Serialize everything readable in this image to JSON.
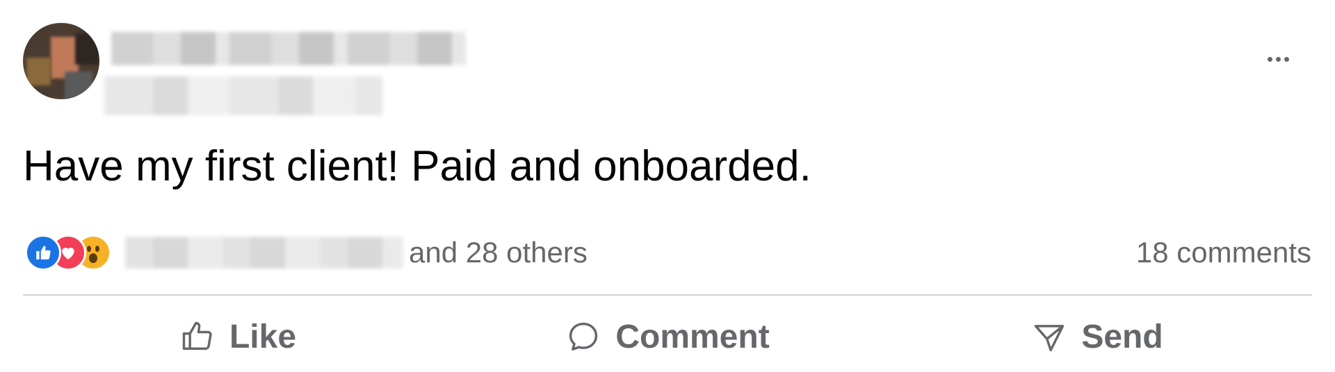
{
  "post": {
    "text": "Have my first client! Paid and onboarded.",
    "reactions": {
      "types": [
        "like",
        "love",
        "wow"
      ],
      "others_text": "and 28 others"
    },
    "comments_text": "18 comments",
    "actions": {
      "like_label": "Like",
      "comment_label": "Comment",
      "send_label": "Send"
    },
    "colors": {
      "like": "#1b74e4",
      "love": "#f33e58",
      "wow": "#f7b125",
      "secondary_text": "#65676b",
      "primary_text": "#050505"
    }
  }
}
